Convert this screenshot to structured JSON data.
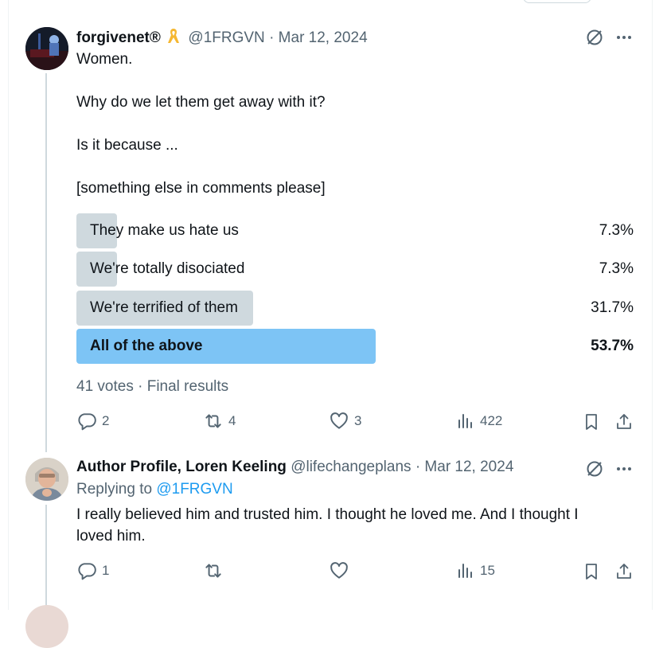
{
  "post": {
    "author_name": "forgivenet®",
    "handle": "@1FRGVN",
    "separator": "·",
    "date": "Mar 12, 2024",
    "body_lines": [
      "Women.",
      "Why do we let them get away with it?",
      "Is it because ...",
      "[something else in comments please]"
    ],
    "poll": {
      "options": [
        {
          "label": "They make us hate us",
          "percent_text": "7.3%",
          "fraction": 0.073
        },
        {
          "label": "We're totally disociated",
          "percent_text": "7.3%",
          "fraction": 0.073
        },
        {
          "label": "We're terrified of them",
          "percent_text": "31.7%",
          "fraction": 0.317
        },
        {
          "label": "All of the above",
          "percent_text": "53.7%",
          "fraction": 0.537,
          "winner": true
        }
      ],
      "summary": "41 votes · Final results",
      "colors": {
        "bar": "#cfd9de",
        "winner_bar": "#7dc4f5"
      }
    },
    "actions": {
      "replies": "2",
      "reposts": "4",
      "likes": "3",
      "views": "422"
    }
  },
  "reply": {
    "author_name": "Author Profile, Loren Keeling",
    "handle": "@lifechangeplans",
    "separator": "·",
    "date": "Mar 12, 2024",
    "replying_to_label": "Replying to",
    "replying_to_handle": "@1FRGVN",
    "body_line_1": "I really believed him and trusted him. I thought he loved me. And I thought I",
    "body_line_2": "loved him.",
    "actions": {
      "replies": "1",
      "views": "15"
    }
  },
  "icons": [
    "grok-icon",
    "more-icon",
    "ribbon-badge-icon",
    "reply-icon",
    "repost-icon",
    "like-icon",
    "views-icon",
    "bookmark-icon",
    "share-icon"
  ],
  "colors": {
    "text": "#0f1419",
    "muted": "#536471",
    "link": "#1d9bf0",
    "thread_line": "#cfd9de"
  }
}
